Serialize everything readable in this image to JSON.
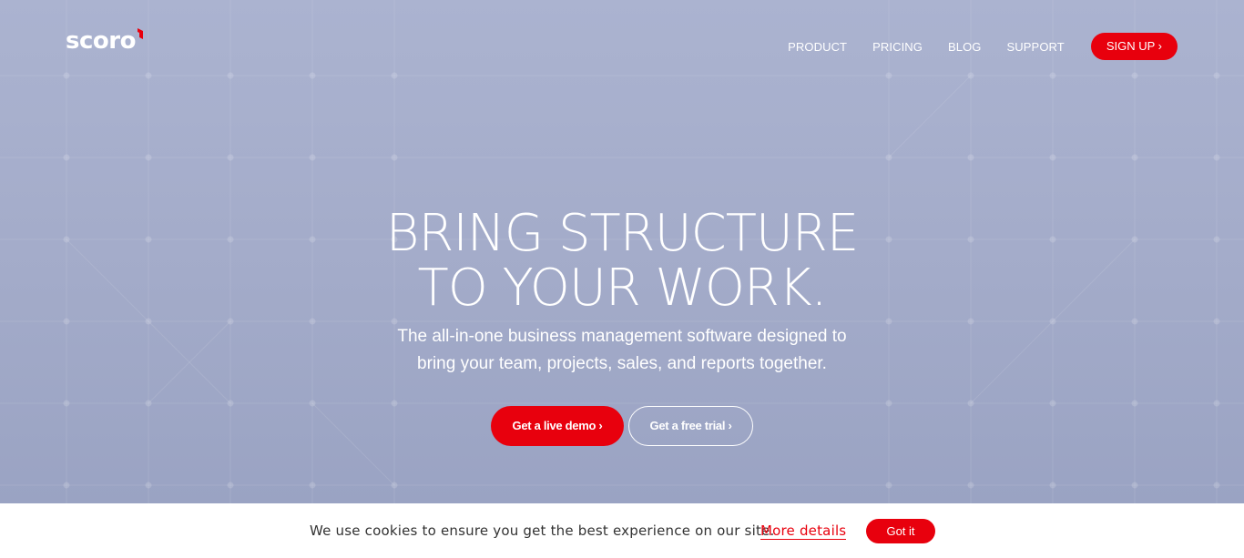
{
  "brand": {
    "logo_text": "scoro",
    "accent_color": "#e8000d"
  },
  "nav": {
    "items": [
      {
        "label": "PRODUCT"
      },
      {
        "label": "PRICING"
      },
      {
        "label": "BLOG"
      },
      {
        "label": "SUPPORT"
      }
    ],
    "signup_label": "SIGN UP ›"
  },
  "hero": {
    "headline_line1": "BRING STRUCTURE",
    "headline_line2": "TO YOUR WORK.",
    "subtitle_line1": "The all-in-one business management software designed to",
    "subtitle_line2": "bring your team, projects, sales, and reports together.",
    "demo_button": "Get a live demo ›",
    "trial_button": "Get a free trial ›"
  },
  "cookie_bar": {
    "message": "We use cookies to ensure you get the best experience on our site.",
    "link_label": "More details",
    "button_label": "Got it"
  }
}
